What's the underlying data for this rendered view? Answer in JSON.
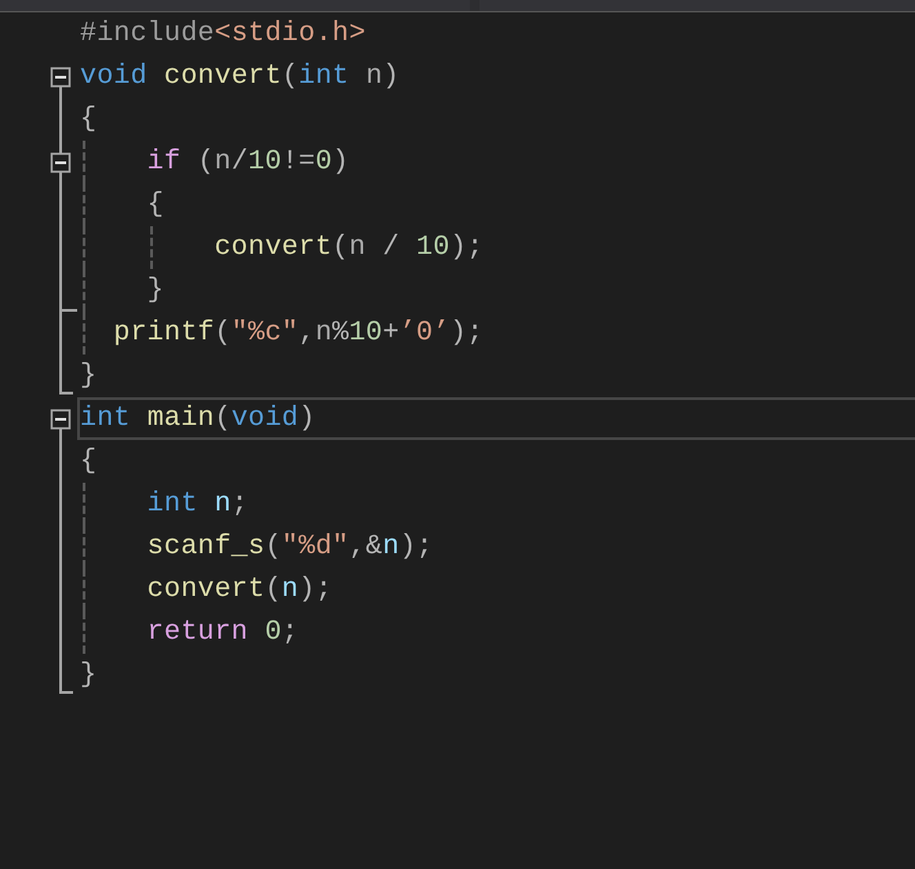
{
  "scope_bar": {
    "dropdowns": [
      {
        "kind": "scope"
      },
      {
        "kind": "scope"
      }
    ]
  },
  "lines": [
    {
      "kind": "statement",
      "current": false,
      "tokens": [
        {
          "text": "#include",
          "kind": "preproc"
        },
        {
          "text": "<stdio.h>",
          "kind": "string"
        }
      ]
    },
    {
      "kind": "statement",
      "current": false,
      "expanded": true,
      "tokens": [
        {
          "text": "void ",
          "kind": "keyword"
        },
        {
          "text": "convert",
          "kind": "function"
        },
        {
          "text": "(",
          "kind": "punct"
        },
        {
          "text": "int ",
          "kind": "keyword"
        },
        {
          "text": "n",
          "kind": "param"
        },
        {
          "text": ")",
          "kind": "punct"
        }
      ],
      "children": [
        {
          "kind": "brace",
          "tokens": [
            {
              "text": "{",
              "kind": "punct"
            }
          ]
        },
        {
          "kind": "statement",
          "expanded": true,
          "tokens": [
            {
              "text": "if",
              "kind": "control"
            },
            {
              "text": " (",
              "kind": "punct"
            },
            {
              "text": "n",
              "kind": "param"
            },
            {
              "text": "/",
              "kind": "punct"
            },
            {
              "text": "10",
              "kind": "number"
            },
            {
              "text": "!=",
              "kind": "punct"
            },
            {
              "text": "0",
              "kind": "number"
            },
            {
              "text": ")",
              "kind": "punct"
            }
          ],
          "children": [
            {
              "kind": "brace",
              "tokens": [
                {
                  "text": "{",
                  "kind": "punct"
                }
              ]
            },
            {
              "kind": "statement",
              "tokens": [
                {
                  "text": "convert",
                  "kind": "function"
                },
                {
                  "text": "(",
                  "kind": "punct"
                },
                {
                  "text": "n",
                  "kind": "param"
                },
                {
                  "text": " / ",
                  "kind": "punct"
                },
                {
                  "text": "10",
                  "kind": "number"
                },
                {
                  "text": ");",
                  "kind": "punct"
                }
              ]
            },
            {
              "kind": "brace",
              "tokens": [
                {
                  "text": "}",
                  "kind": "punct"
                }
              ]
            }
          ]
        },
        {
          "kind": "half",
          "tokens": [
            {
              "text": "printf",
              "kind": "function"
            },
            {
              "text": "(",
              "kind": "punct"
            },
            {
              "text": "″%c″",
              "kind": "string"
            },
            {
              "text": ",",
              "kind": "punct"
            },
            {
              "text": "n",
              "kind": "param"
            },
            {
              "text": "%",
              "kind": "punct"
            },
            {
              "text": "10",
              "kind": "number"
            },
            {
              "text": "+",
              "kind": "punct"
            },
            {
              "text": "’0’",
              "kind": "string"
            },
            {
              "text": ");",
              "kind": "punct"
            }
          ]
        },
        {
          "kind": "brace",
          "tokens": [
            {
              "text": "}",
              "kind": "punct"
            }
          ]
        }
      ]
    },
    {
      "kind": "statement",
      "current": true,
      "expanded": true,
      "tokens": [
        {
          "text": "int ",
          "kind": "keyword"
        },
        {
          "text": "main",
          "kind": "function"
        },
        {
          "text": "(",
          "kind": "punct"
        },
        {
          "text": "void",
          "kind": "keyword"
        },
        {
          "text": ")",
          "kind": "punct"
        }
      ],
      "children": [
        {
          "kind": "brace",
          "tokens": [
            {
              "text": "{",
              "kind": "punct"
            }
          ]
        },
        {
          "kind": "statement",
          "tokens": [
            {
              "text": "int ",
              "kind": "keyword"
            },
            {
              "text": "n",
              "kind": "local"
            },
            {
              "text": ";",
              "kind": "punct"
            }
          ]
        },
        {
          "kind": "statement",
          "tokens": [
            {
              "text": "scanf_s",
              "kind": "function"
            },
            {
              "text": "(",
              "kind": "punct"
            },
            {
              "text": "″%d″",
              "kind": "string"
            },
            {
              "text": ",&",
              "kind": "punct"
            },
            {
              "text": "n",
              "kind": "local"
            },
            {
              "text": ");",
              "kind": "punct"
            }
          ]
        },
        {
          "kind": "statement",
          "tokens": [
            {
              "text": "convert",
              "kind": "function"
            },
            {
              "text": "(",
              "kind": "punct"
            },
            {
              "text": "n",
              "kind": "local"
            },
            {
              "text": ");",
              "kind": "punct"
            }
          ]
        },
        {
          "kind": "statement",
          "tokens": [
            {
              "text": "return ",
              "kind": "control"
            },
            {
              "text": "0",
              "kind": "number"
            },
            {
              "text": ";",
              "kind": "punct"
            }
          ]
        },
        {
          "kind": "brace",
          "tokens": [
            {
              "text": "}",
              "kind": "punct"
            }
          ]
        }
      ]
    }
  ]
}
